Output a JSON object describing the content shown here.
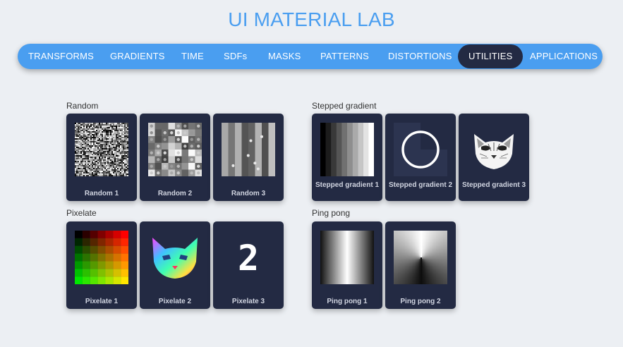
{
  "header": {
    "title": "UI MATERIAL LAB"
  },
  "nav": {
    "items": [
      {
        "label": "TRANSFORMS"
      },
      {
        "label": "GRADIENTS"
      },
      {
        "label": "TIME"
      },
      {
        "label": "SDFs"
      },
      {
        "label": "MASKS"
      },
      {
        "label": "PATTERNS"
      },
      {
        "label": "DISTORTIONS"
      },
      {
        "label": "UTILITIES",
        "active": true
      },
      {
        "label": "APPLICATIONS"
      }
    ]
  },
  "sections": {
    "random": {
      "title": "Random",
      "cards": [
        {
          "label": "Random 1"
        },
        {
          "label": "Random 2"
        },
        {
          "label": "Random 3"
        }
      ]
    },
    "stepped": {
      "title": "Stepped gradient",
      "cards": [
        {
          "label": "Stepped gradient 1"
        },
        {
          "label": "Stepped gradient 2"
        },
        {
          "label": "Stepped gradient 3"
        }
      ]
    },
    "pixelate": {
      "title": "Pixelate",
      "cards": [
        {
          "label": "Pixelate 1"
        },
        {
          "label": "Pixelate 2"
        },
        {
          "label": "Pixelate 3"
        }
      ]
    },
    "pingpong": {
      "title": "Ping pong",
      "cards": [
        {
          "label": "Ping pong 1"
        },
        {
          "label": "Ping pong 2"
        }
      ]
    }
  },
  "thumbs": {
    "pixelate3_glyph": "2"
  },
  "colors": {
    "accent": "#4a9ef0",
    "card": "#232a43",
    "background": "#eceff3"
  }
}
